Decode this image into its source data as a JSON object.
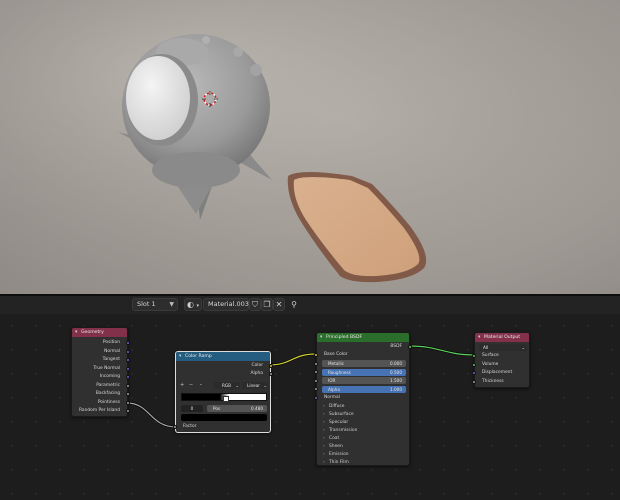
{
  "viewport": {
    "description_colors": {
      "body": "#9c9c9c",
      "face": "#ebebeb",
      "board": "#d6a67f"
    }
  },
  "header": {
    "slot_label": "Slot 1",
    "material_name": "Material.003"
  },
  "nodes": {
    "geometry": {
      "title": "Geometry",
      "title_color": "#83314a",
      "outputs": [
        "Position",
        "Normal",
        "Tangent",
        "True Normal",
        "Incoming",
        "Parametric",
        "Backfacing",
        "Pointiness",
        "Random Per Island"
      ]
    },
    "color_ramp": {
      "title": "Color Ramp",
      "title_color": "#245d80",
      "outputs": [
        "Color",
        "Alpha"
      ],
      "mode": "RGB",
      "interpolation": "Linear",
      "stop_index": "0",
      "pos_label": "Pos",
      "pos_value": "0.480",
      "input": "Factor",
      "plus": "+",
      "minus": "−"
    },
    "principled": {
      "title": "Principled BSDF",
      "title_color": "#2b6e2b",
      "output": "BSDF",
      "base_color": "Base Color",
      "fields": [
        {
          "label": "Metallic",
          "value": "0.000",
          "highlight": false
        },
        {
          "label": "Roughness",
          "value": "0.500",
          "highlight": true
        },
        {
          "label": "IOR",
          "value": "1.500",
          "highlight": false
        },
        {
          "label": "Alpha",
          "value": "1.000",
          "highlight": true
        }
      ],
      "normal": "Normal",
      "panels": [
        "Diffuse",
        "Subsurface",
        "Specular",
        "Transmission",
        "Coat",
        "Sheen",
        "Emission",
        "Thin Film"
      ]
    },
    "material_output": {
      "title": "Material Output",
      "title_color": "#83314a",
      "target": "All",
      "inputs": [
        "Surface",
        "Volume",
        "Displacement",
        "Thickness"
      ]
    }
  }
}
